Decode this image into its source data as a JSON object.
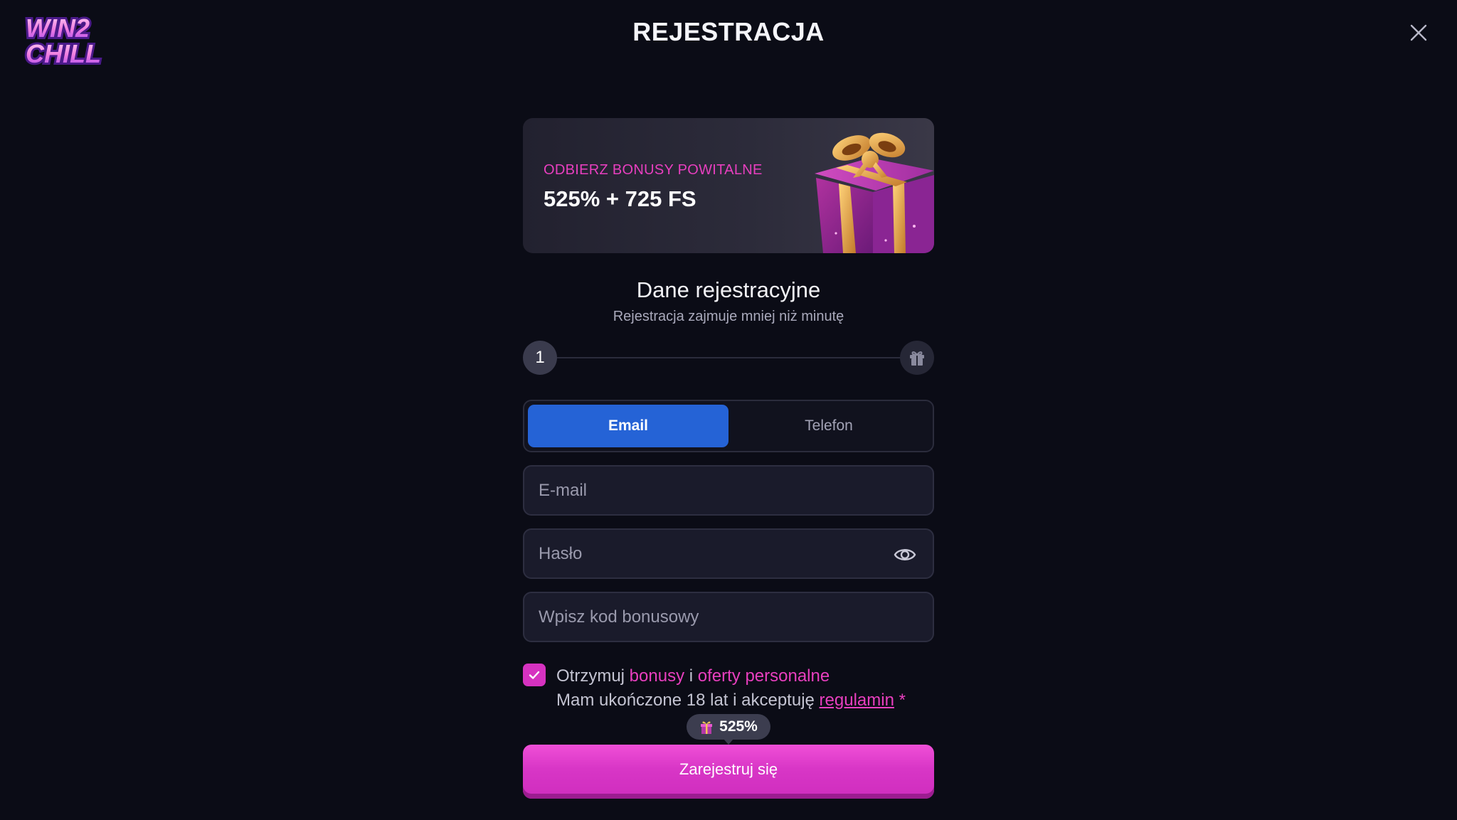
{
  "logo": {
    "line1": "WIN2",
    "line2": "CHILL"
  },
  "header": {
    "title": "REJESTRACJA"
  },
  "banner": {
    "subtitle": "ODBIERZ BONUSY POWITALNE",
    "offer": "525% + 725 FS"
  },
  "section": {
    "title": "Dane rejestracyjne",
    "subtitle": "Rejestracja zajmuje mniej niż minutę"
  },
  "progress": {
    "current_step": "1"
  },
  "tabs": [
    {
      "label": "Email",
      "active": true
    },
    {
      "label": "Telefon",
      "active": false
    }
  ],
  "fields": {
    "email": {
      "placeholder": "E-mail",
      "value": ""
    },
    "password": {
      "placeholder": "Hasło",
      "value": ""
    },
    "bonus": {
      "placeholder": "Wpisz kod bonusowy",
      "value": ""
    }
  },
  "consent": {
    "checked": true,
    "line1_prefix": "Otrzymuj",
    "line1_link1": "bonusy",
    "line1_mid": "i",
    "line1_link2": "oferty personalne",
    "line2_prefix": "Mam ukończone 18 lat i akceptuję",
    "line2_link": "regulamin",
    "required_mark": "*"
  },
  "badge": {
    "label": "525%"
  },
  "submit": {
    "label": "Zarejestruj się"
  },
  "colors": {
    "background": "#0b0c16",
    "accent_pink": "#e83fbf",
    "tab_active": "#2563d6",
    "submit": "#d836c6"
  },
  "icons": [
    "close-icon",
    "gift-icon",
    "eye-icon",
    "check-icon",
    "gift-box-illustration"
  ]
}
